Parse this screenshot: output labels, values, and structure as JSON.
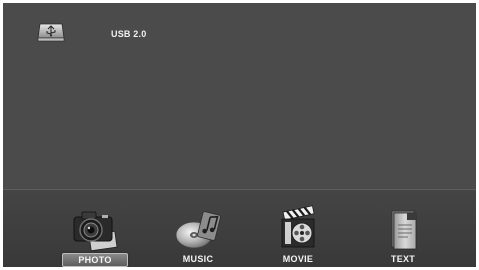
{
  "device": {
    "label": "USB 2.0",
    "icon": "usb-drive-icon"
  },
  "media_bar": {
    "items": [
      {
        "label": "PHOTO",
        "icon": "camera-icon",
        "selected": true
      },
      {
        "label": "MUSIC",
        "icon": "music-disc-icon",
        "selected": false
      },
      {
        "label": "MOVIE",
        "icon": "film-reel-icon",
        "selected": false
      },
      {
        "label": "TEXT",
        "icon": "text-document-icon",
        "selected": false
      }
    ]
  }
}
